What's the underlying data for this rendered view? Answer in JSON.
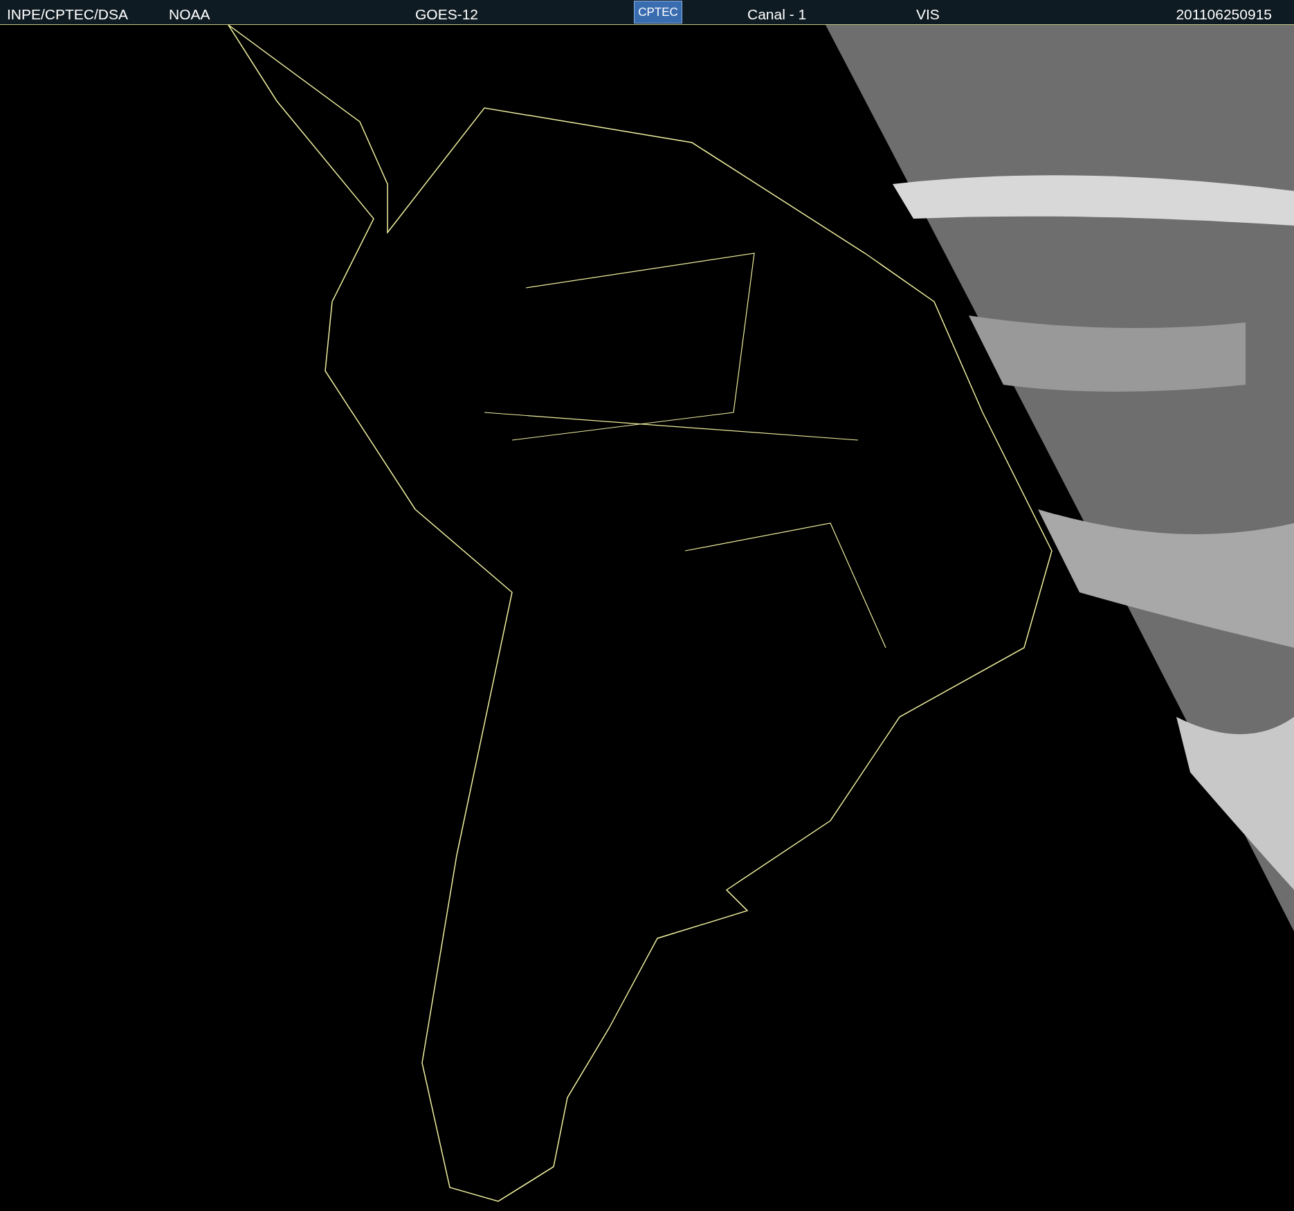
{
  "header": {
    "items": [
      "INPE/CPTEC/DSA",
      "NOAA",
      "GOES-12"
    ],
    "logo": "CPTEC",
    "items_right": [
      "Canal - 1",
      "VIS"
    ],
    "timestamp": "201106250915"
  }
}
